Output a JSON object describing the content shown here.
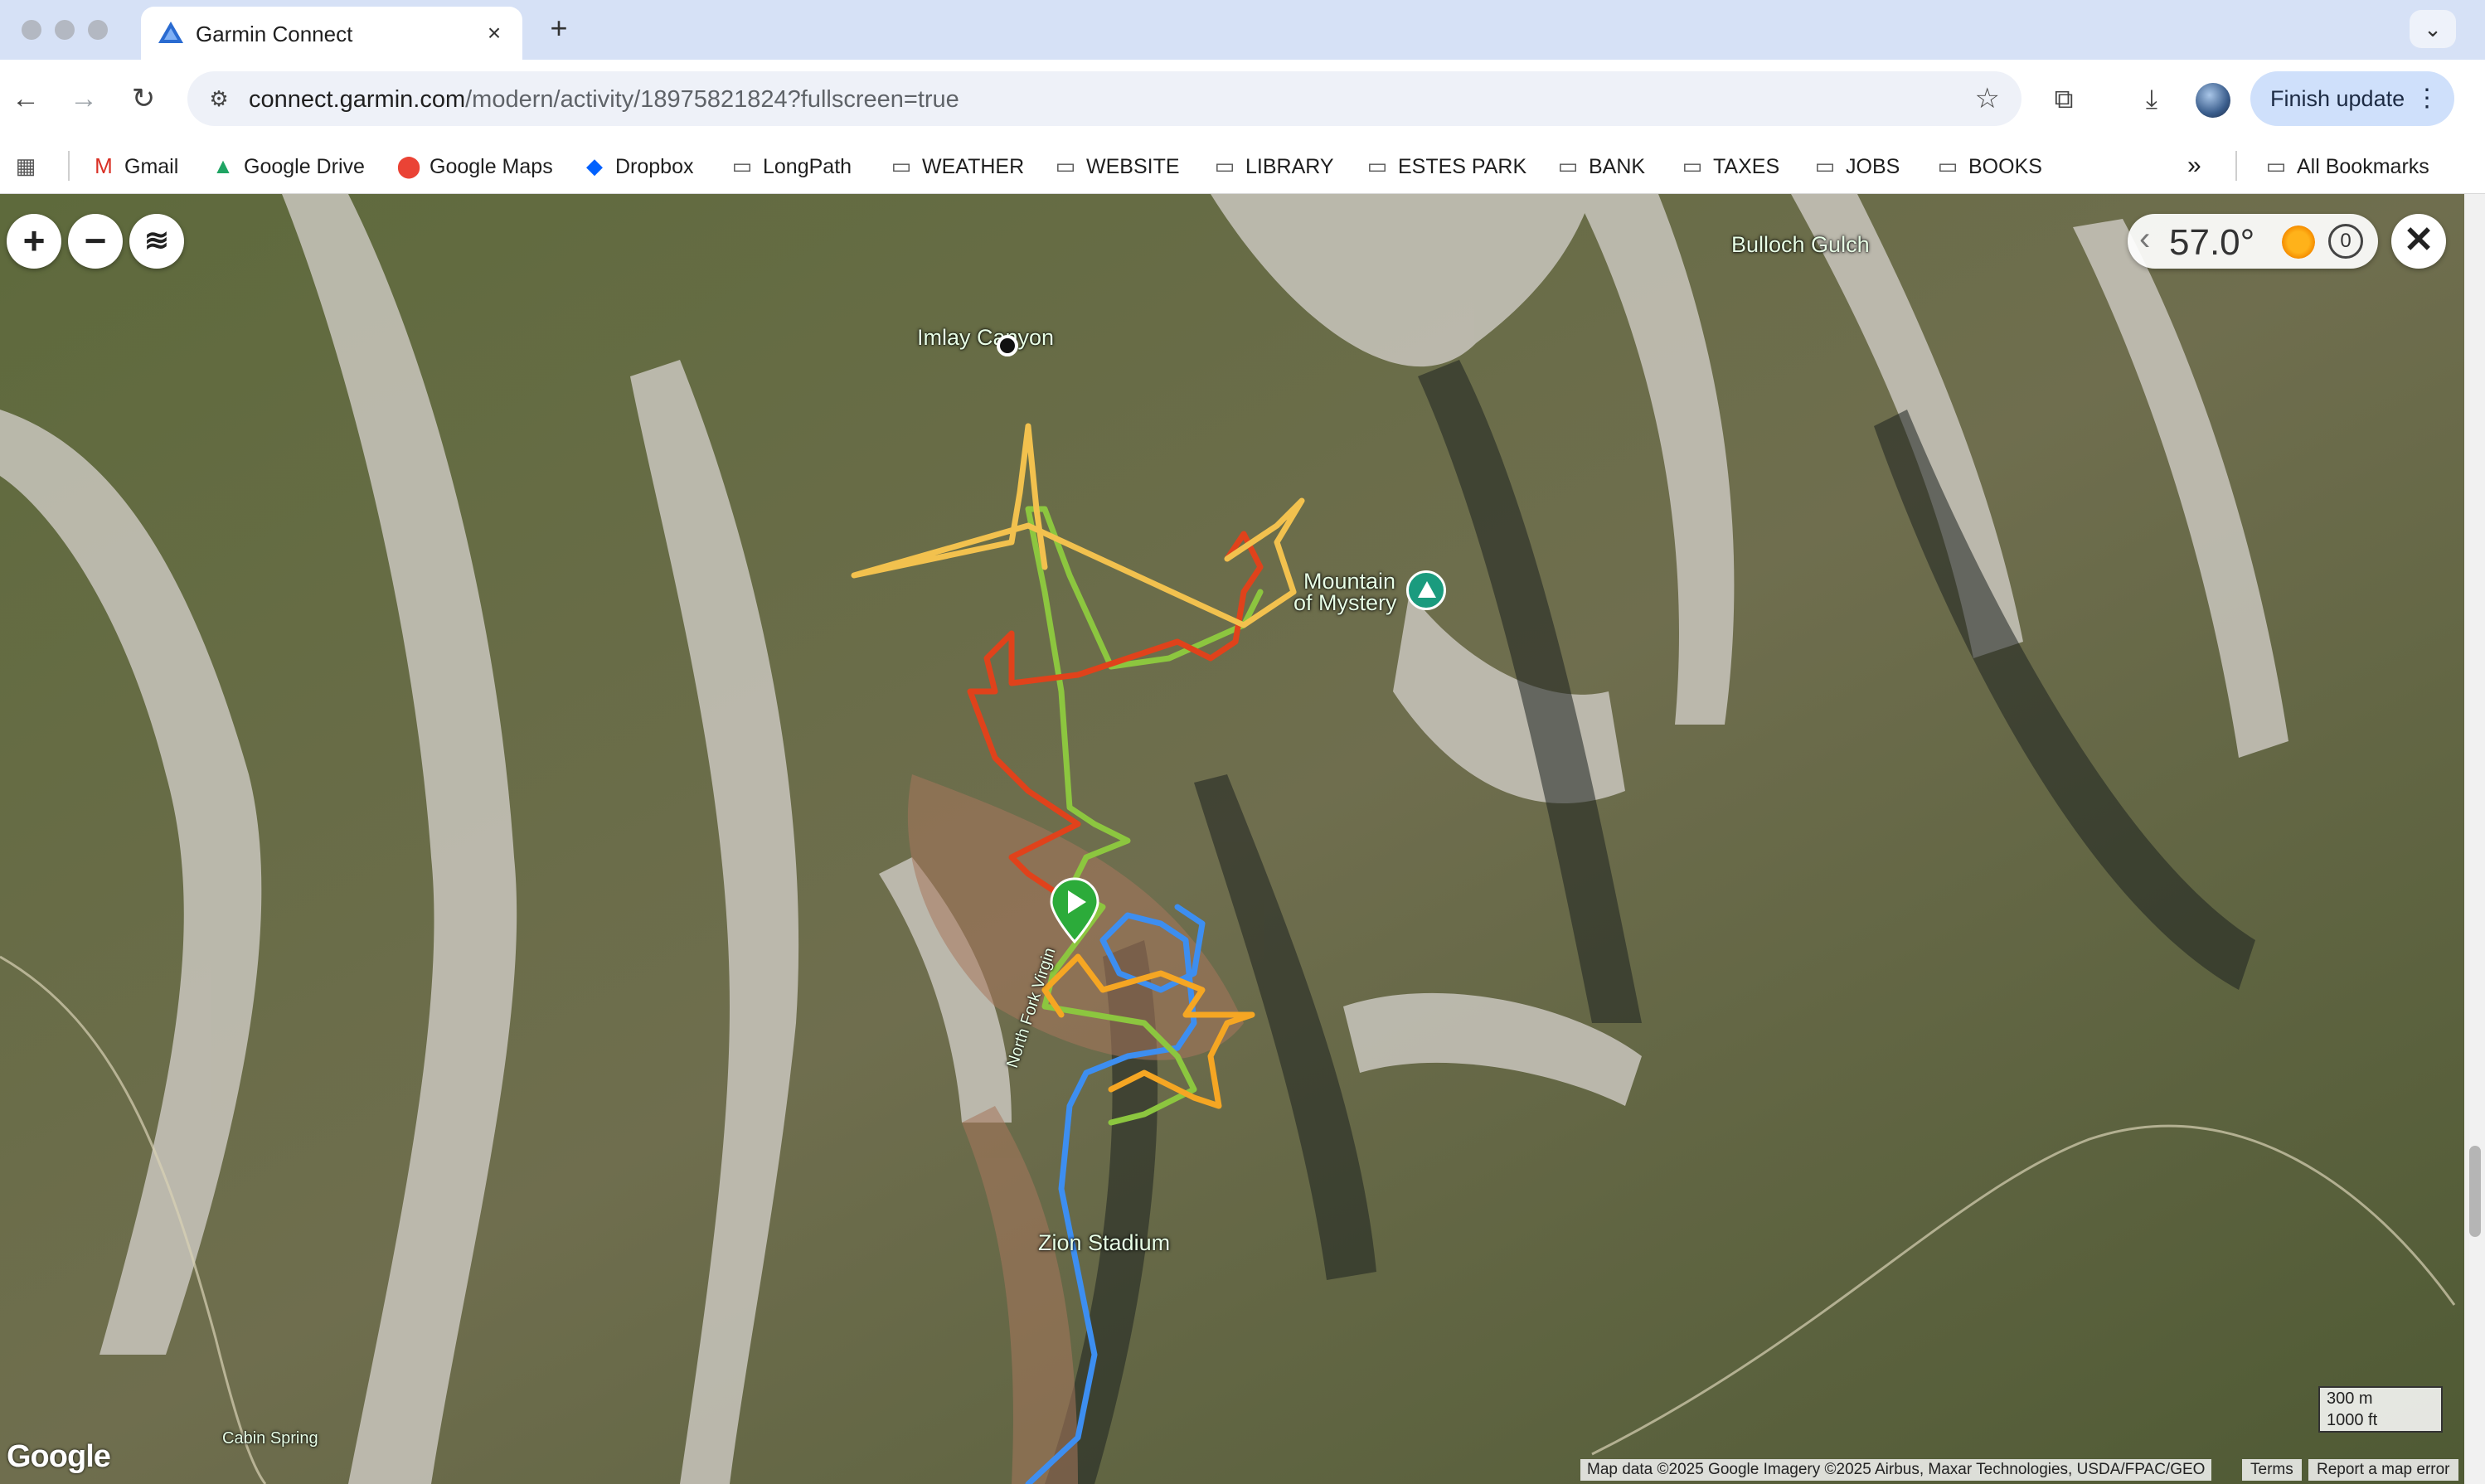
{
  "browser": {
    "tab": {
      "title": "Garmin Connect",
      "close_icon": "×"
    },
    "new_tab_icon": "+",
    "tab_list_icon": "⌄",
    "url_host": "connect.garmin.com",
    "url_path": "/modern/activity/18975821824?fullscreen=true",
    "finish_update_label": "Finish update",
    "bookmarks": [
      {
        "label": "Gmail",
        "icon": "gmail-icon"
      },
      {
        "label": "Google Drive",
        "icon": "google-drive-icon"
      },
      {
        "label": "Google Maps",
        "icon": "google-maps-icon"
      },
      {
        "label": "Dropbox",
        "icon": "dropbox-icon"
      },
      {
        "label": "LongPath",
        "icon": "folder-icon"
      },
      {
        "label": "WEATHER",
        "icon": "folder-icon"
      },
      {
        "label": "WEBSITE",
        "icon": "folder-icon"
      },
      {
        "label": "LIBRARY",
        "icon": "folder-icon"
      },
      {
        "label": "ESTES PARK",
        "icon": "folder-icon"
      },
      {
        "label": "BANK",
        "icon": "folder-icon"
      },
      {
        "label": "TAXES",
        "icon": "folder-icon"
      },
      {
        "label": "JOBS",
        "icon": "folder-icon"
      },
      {
        "label": "BOOKS",
        "icon": "folder-icon"
      }
    ],
    "all_bookmarks_label": "All Bookmarks",
    "more_bookmarks_icon": "»"
  },
  "map": {
    "zoom_in": "+",
    "zoom_out": "−",
    "layers_icon": "layers-icon",
    "weather": {
      "temperature": "57.0°",
      "timer_value": "0"
    },
    "close_icon": "✕",
    "labels": {
      "bulloch_gulch": "Bulloch Gulch",
      "imlay_canyon": "Imlay Canyon",
      "mountain_of_mystery_1": "Mountain",
      "mountain_of_mystery_2": "of Mystery",
      "zion_stadium": "Zion Stadium",
      "north_fork_virgin": "North Fork Virgin",
      "cabin_spring": "Cabin Spring"
    },
    "google_logo": "Google",
    "scale": {
      "metric": "300 m",
      "imperial": "1000 ft"
    },
    "attribution": "Map data ©2025 Google Imagery ©2025 Airbus, Maxar Technologies, USDA/FPAC/GEO",
    "terms": "Terms",
    "report": "Report a map error",
    "track_colors": {
      "blue": "#3d8ef0",
      "green": "#8cc63f",
      "orange": "#f5a623",
      "red": "#e0421b",
      "yellow": "#f2c14e"
    }
  }
}
